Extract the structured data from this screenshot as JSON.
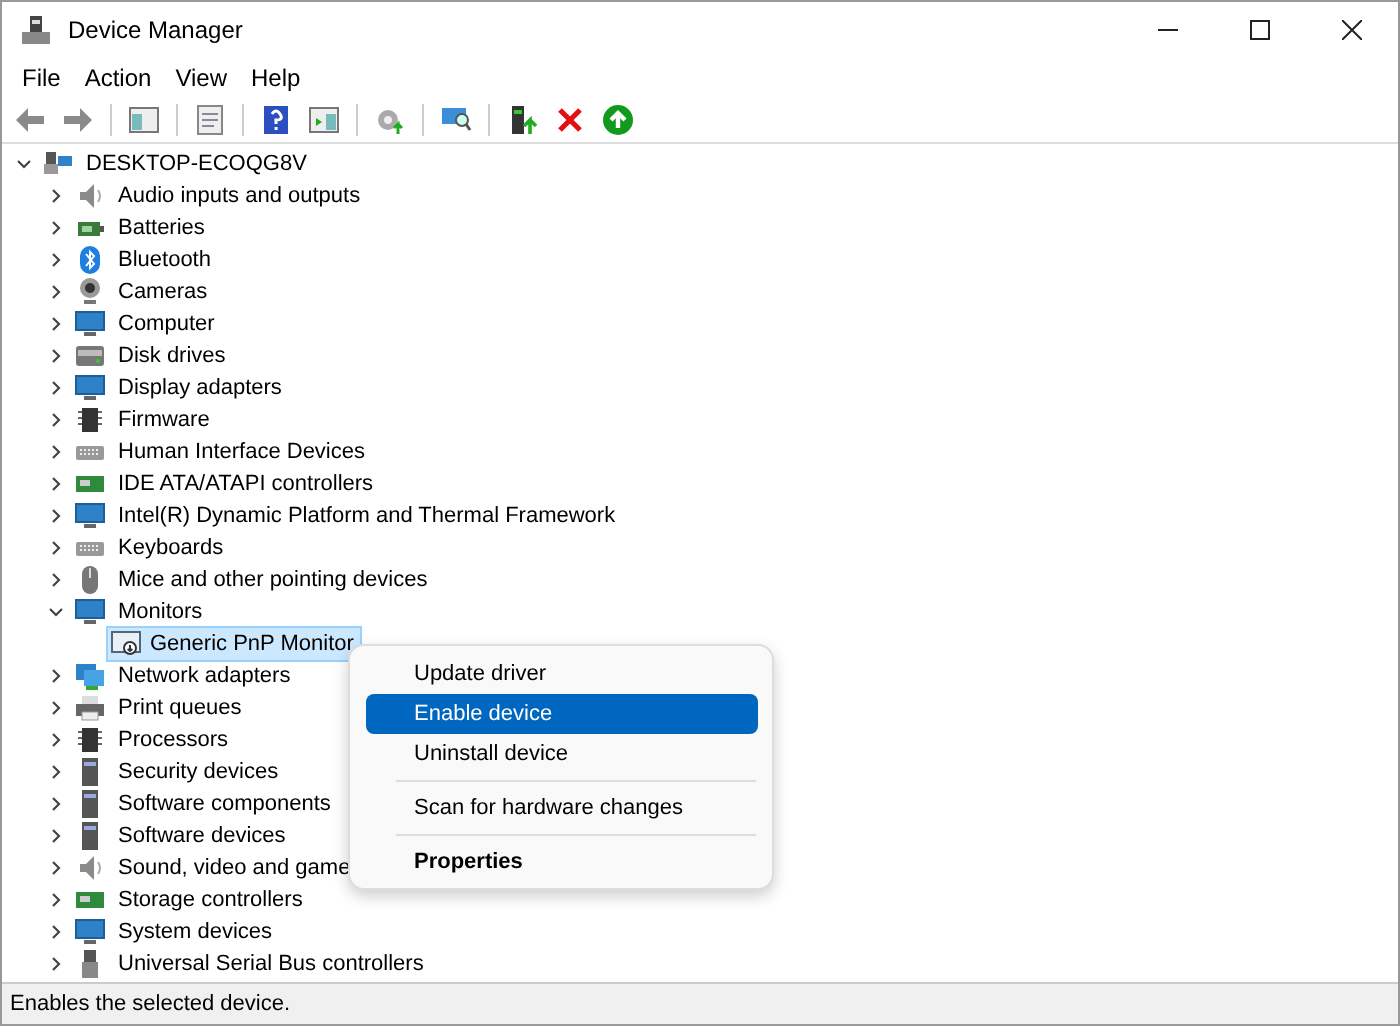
{
  "window": {
    "title": "Device Manager"
  },
  "menu_bar": [
    "File",
    "Action",
    "View",
    "Help"
  ],
  "tree": {
    "label": "DESKTOP-ECOQG8V",
    "expanded": true,
    "selected": false,
    "children": [
      {
        "label": "Audio inputs and outputs",
        "expanded": false,
        "selected": false
      },
      {
        "label": "Batteries",
        "expanded": false,
        "selected": false
      },
      {
        "label": "Bluetooth",
        "expanded": false,
        "selected": false
      },
      {
        "label": "Cameras",
        "expanded": false,
        "selected": false
      },
      {
        "label": "Computer",
        "expanded": false,
        "selected": false
      },
      {
        "label": "Disk drives",
        "expanded": false,
        "selected": false
      },
      {
        "label": "Display adapters",
        "expanded": false,
        "selected": false
      },
      {
        "label": "Firmware",
        "expanded": false,
        "selected": false
      },
      {
        "label": "Human Interface Devices",
        "expanded": false,
        "selected": false
      },
      {
        "label": "IDE ATA/ATAPI controllers",
        "expanded": false,
        "selected": false
      },
      {
        "label": "Intel(R) Dynamic Platform and Thermal Framework",
        "expanded": false,
        "selected": false
      },
      {
        "label": "Keyboards",
        "expanded": false,
        "selected": false
      },
      {
        "label": "Mice and other pointing devices",
        "expanded": false,
        "selected": false
      },
      {
        "label": "Monitors",
        "expanded": true,
        "selected": false,
        "children": [
          {
            "label": "Generic PnP Monitor",
            "selected": true
          }
        ]
      },
      {
        "label": "Network adapters",
        "expanded": false,
        "selected": false
      },
      {
        "label": "Print queues",
        "expanded": false,
        "selected": false
      },
      {
        "label": "Processors",
        "expanded": false,
        "selected": false
      },
      {
        "label": "Security devices",
        "expanded": false,
        "selected": false
      },
      {
        "label": "Software components",
        "expanded": false,
        "selected": false
      },
      {
        "label": "Software devices",
        "expanded": false,
        "selected": false
      },
      {
        "label": "Sound, video and game",
        "expanded": false,
        "selected": false
      },
      {
        "label": "Storage controllers",
        "expanded": false,
        "selected": false
      },
      {
        "label": "System devices",
        "expanded": false,
        "selected": false
      },
      {
        "label": "Universal Serial Bus controllers",
        "expanded": false,
        "selected": false
      }
    ]
  },
  "context_menu": [
    {
      "kind": "item",
      "label": "Update driver",
      "selected": false,
      "default": false
    },
    {
      "kind": "item",
      "label": "Enable device",
      "selected": true,
      "default": false
    },
    {
      "kind": "item",
      "label": "Uninstall device",
      "selected": false,
      "default": false
    },
    {
      "kind": "separator"
    },
    {
      "kind": "item",
      "label": "Scan for hardware changes",
      "selected": false,
      "default": false
    },
    {
      "kind": "separator"
    },
    {
      "kind": "item",
      "label": "Properties",
      "selected": false,
      "default": true
    }
  ],
  "status_bar": "Enables the selected device."
}
